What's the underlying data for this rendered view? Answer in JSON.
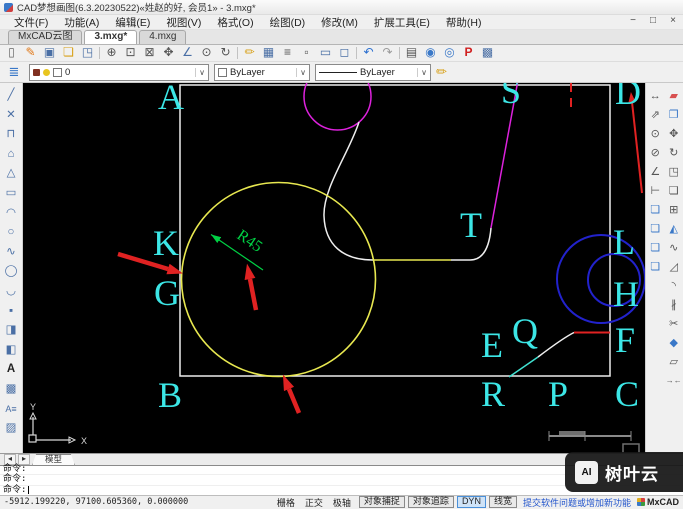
{
  "window": {
    "title": "CAD梦想画图(6.3.20230522)«姓赵的好, 会员1» - 3.mxg*",
    "controls": {
      "minimize": "−",
      "maximize": "□",
      "close": "×"
    }
  },
  "menu": {
    "items": [
      "文件(F)",
      "功能(A)",
      "编辑(E)",
      "视图(V)",
      "格式(O)",
      "绘图(D)",
      "修改(M)",
      "扩展工具(E)",
      "帮助(H)"
    ]
  },
  "tabs": {
    "items": [
      {
        "label": "MxCAD云图"
      },
      {
        "label": "3.mxg*"
      },
      {
        "label": "4.mxg"
      }
    ]
  },
  "glyphs": {
    "chevron": "∨"
  },
  "toolbar1": [
    {
      "name": "new-file",
      "glyph": "▯"
    },
    {
      "name": "sketch-save",
      "glyph": "✎"
    },
    {
      "name": "save",
      "glyph": "▣"
    },
    {
      "name": "open-folder",
      "glyph": "❏"
    },
    {
      "name": "save-as",
      "glyph": "◳"
    },
    {
      "name": "zoom-in",
      "glyph": "⊕"
    },
    {
      "name": "zoom-window",
      "glyph": "⊡"
    },
    {
      "name": "zoom-extents",
      "glyph": "⊠"
    },
    {
      "name": "pan",
      "glyph": "✥"
    },
    {
      "name": "measure-angle",
      "glyph": "∠"
    },
    {
      "name": "zoom-object",
      "glyph": "⊙"
    },
    {
      "name": "rotate-view",
      "glyph": "↻"
    },
    {
      "name": "draw-pencil",
      "glyph": "✏"
    },
    {
      "name": "table",
      "glyph": "▦"
    },
    {
      "name": "text-style",
      "glyph": "≡"
    },
    {
      "name": "page-setup",
      "glyph": "▫"
    },
    {
      "name": "display-settings",
      "glyph": "▭"
    },
    {
      "name": "computer-sync",
      "glyph": "◻"
    },
    {
      "name": "undo",
      "glyph": "↶"
    },
    {
      "name": "redo",
      "glyph": "↷"
    },
    {
      "name": "print",
      "glyph": "▤"
    },
    {
      "name": "web-publish",
      "glyph": "◉"
    },
    {
      "name": "web-map",
      "glyph": "◎"
    },
    {
      "name": "export-pdf",
      "glyph": "P"
    },
    {
      "name": "insert-image",
      "glyph": "▩"
    }
  ],
  "properties_bar": {
    "layer": {
      "value": "0"
    },
    "color": {
      "value": "ByLayer"
    },
    "linetype": {
      "value": "ByLayer"
    },
    "pencil_glyph": "✏",
    "layers_glyph": "≣"
  },
  "draw_tools": [
    {
      "name": "line",
      "glyph": "╱"
    },
    {
      "name": "construction-line",
      "glyph": "✕"
    },
    {
      "name": "polyline",
      "glyph": "⊓"
    },
    {
      "name": "polygon",
      "glyph": "⌂"
    },
    {
      "name": "polygon-inscribed",
      "glyph": "△"
    },
    {
      "name": "rectangle",
      "glyph": "▭"
    },
    {
      "name": "arc",
      "glyph": "◠"
    },
    {
      "name": "circle",
      "glyph": "○"
    },
    {
      "name": "spline",
      "glyph": "∿"
    },
    {
      "name": "ellipse",
      "glyph": "◯"
    },
    {
      "name": "revision-arc",
      "glyph": "◡"
    },
    {
      "name": "point",
      "glyph": "▪"
    },
    {
      "name": "insert-block",
      "glyph": "◨"
    },
    {
      "name": "create-block",
      "glyph": "◧"
    },
    {
      "name": "text",
      "glyph": "A"
    },
    {
      "name": "image",
      "glyph": "▩"
    },
    {
      "name": "mtext",
      "glyph": "A≡"
    },
    {
      "name": "hatch",
      "glyph": "▨"
    }
  ],
  "dim_tools": [
    {
      "name": "dim-linear",
      "glyph": "↔"
    },
    {
      "name": "dim-aligned",
      "glyph": "⇗"
    },
    {
      "name": "dim-radius",
      "glyph": "⊙"
    },
    {
      "name": "dim-diameter",
      "glyph": "⊘"
    },
    {
      "name": "dim-angular",
      "glyph": "∠"
    },
    {
      "name": "dim-continue",
      "glyph": "⊢"
    },
    {
      "name": "viewport-a",
      "glyph": "❏"
    },
    {
      "name": "viewport-b",
      "glyph": "❏"
    },
    {
      "name": "viewport-c",
      "glyph": "❏"
    },
    {
      "name": "viewport-d",
      "glyph": "❏"
    }
  ],
  "modify_tools": [
    {
      "name": "erase",
      "glyph": "▰"
    },
    {
      "name": "copy",
      "glyph": "❐"
    },
    {
      "name": "move",
      "glyph": "✥"
    },
    {
      "name": "rotate",
      "glyph": "↻"
    },
    {
      "name": "scale",
      "glyph": "◳"
    },
    {
      "name": "offset",
      "glyph": "❏"
    },
    {
      "name": "array",
      "glyph": "⊞"
    },
    {
      "name": "mirror",
      "glyph": "◭"
    },
    {
      "name": "curve-edit",
      "glyph": "∿"
    },
    {
      "name": "chamfer",
      "glyph": "◿"
    },
    {
      "name": "fillet",
      "glyph": "◝"
    },
    {
      "name": "break",
      "glyph": "∦"
    },
    {
      "name": "trim",
      "glyph": "✂"
    },
    {
      "name": "explode",
      "glyph": "◆"
    },
    {
      "name": "stretch",
      "glyph": "▱"
    },
    {
      "name": "join",
      "glyph": "→←"
    }
  ],
  "canvas": {
    "labels": [
      {
        "char": "A"
      },
      {
        "char": "S"
      },
      {
        "char": "D"
      },
      {
        "char": "K"
      },
      {
        "char": "G"
      },
      {
        "char": "T"
      },
      {
        "char": "L"
      },
      {
        "char": "H"
      },
      {
        "char": "Q"
      },
      {
        "char": "E"
      },
      {
        "char": "F"
      },
      {
        "char": "B"
      },
      {
        "char": "R"
      },
      {
        "char": "P"
      },
      {
        "char": "C"
      }
    ],
    "dimension": {
      "label": "R45",
      "color": "#00d044"
    },
    "ucs": {
      "x_label": "X",
      "y_label": "Y"
    },
    "colors": {
      "letters": "#3ce6e6",
      "yellow_circle": "#e8e850",
      "magenta": "#dd22dd",
      "blue_circles": "#2222cc",
      "red": "#e02222",
      "white_lines": "#eeeeee",
      "teal": "#40e0d0",
      "green_dim": "#00d044",
      "background": "#000000"
    }
  },
  "model_bar": {
    "tab": "模型",
    "prev": "◂",
    "next": "▸"
  },
  "command": {
    "lines": [
      "命令:",
      "命令:",
      "命令:"
    ]
  },
  "status": {
    "coordinates": "-5912.199220,  97100.605360,  0.000000",
    "flat_toggles": [
      "栅格",
      "正交",
      "极轴"
    ],
    "buttons": [
      {
        "label": "对象捕捉",
        "active": false
      },
      {
        "label": "对象追踪",
        "active": false
      },
      {
        "label": "DYN",
        "active": true
      },
      {
        "label": "线宽",
        "active": false
      }
    ],
    "link": "提交软件问题或增加新功能",
    "brand": "MxCAD"
  },
  "watermark": {
    "logo": "AI",
    "name": "树叶云"
  }
}
